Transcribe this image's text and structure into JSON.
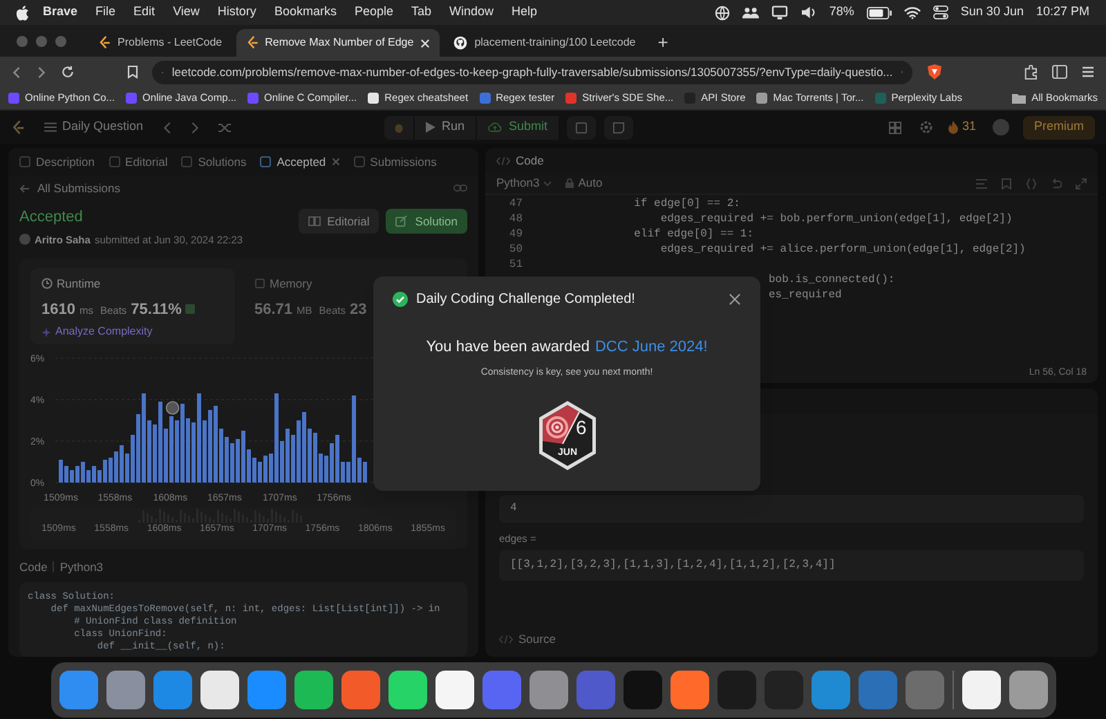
{
  "menu_bar": {
    "app": "Brave",
    "menus": [
      "File",
      "Edit",
      "View",
      "History",
      "Bookmarks",
      "People",
      "Tab",
      "Window",
      "Help"
    ],
    "battery": "78%",
    "date": "Sun 30 Jun",
    "time": "10:27 PM"
  },
  "browser": {
    "tabs": [
      {
        "title": "Problems - LeetCode",
        "selected": false
      },
      {
        "title": "Remove Max Number of Edge",
        "selected": true
      },
      {
        "title": "placement-training/100 Leetcode",
        "selected": false
      }
    ],
    "new_tab": "+",
    "url": "leetcode.com/problems/remove-max-number-of-edges-to-keep-graph-fully-traversable/submissions/1305007355/?envType=daily-questio...",
    "bookmarks": [
      {
        "label": "Online Python Co...",
        "color": "#6d4aff"
      },
      {
        "label": "Online Java Comp...",
        "color": "#6d4aff"
      },
      {
        "label": "Online C Compiler...",
        "color": "#6d4aff"
      },
      {
        "label": "Regex cheatsheet",
        "color": "#e5e5e5"
      },
      {
        "label": "Regex tester",
        "color": "#3b6fd9"
      },
      {
        "label": "Striver's SDE She...",
        "color": "#e0342b"
      },
      {
        "label": "API Store",
        "color": "#222222"
      },
      {
        "label": "Mac Torrents | Tor...",
        "color": "#9a9a9a"
      },
      {
        "label": "Perplexity Labs",
        "color": "#1f5f5a"
      }
    ],
    "all_bookmarks": "All Bookmarks"
  },
  "leetcode_nav": {
    "title": "Daily Question",
    "run": "Run",
    "submit": "Submit",
    "streak": "31",
    "premium": "Premium"
  },
  "left_panel": {
    "tabs": [
      {
        "label": "Description",
        "selected": false
      },
      {
        "label": "Editorial",
        "selected": false
      },
      {
        "label": "Solutions",
        "selected": false
      },
      {
        "label": "Accepted",
        "selected": true
      },
      {
        "label": "Submissions",
        "selected": false
      }
    ],
    "back_link": "All Submissions",
    "status": "Accepted",
    "author": "Aritro Saha",
    "submitted": "submitted at Jun 30, 2024 22:23",
    "buttons": [
      {
        "label": "Editorial",
        "kind": "secondary"
      },
      {
        "label": "Solution",
        "kind": "primary"
      }
    ],
    "runtime": {
      "label": "Runtime",
      "value": "1610",
      "unit": "ms",
      "beats_label": "Beats",
      "beats": "75.11%",
      "analyze": "Analyze Complexity"
    },
    "memory": {
      "label": "Memory",
      "value": "56.71",
      "unit": "MB",
      "beats_label": "Beats",
      "beats": "23"
    },
    "chart_data": {
      "type": "bar",
      "x": [
        1509,
        1514,
        1519,
        1524,
        1529,
        1534,
        1539,
        1544,
        1549,
        1554,
        1559,
        1564,
        1569,
        1574,
        1579,
        1584,
        1589,
        1594,
        1599,
        1604,
        1609,
        1614,
        1619,
        1624,
        1629,
        1634,
        1639,
        1644,
        1649,
        1654,
        1659,
        1664,
        1669,
        1674,
        1679,
        1684,
        1689,
        1694,
        1699,
        1704,
        1709,
        1714,
        1719,
        1724,
        1729,
        1734,
        1739,
        1744,
        1749,
        1754,
        1759,
        1764,
        1769,
        1774,
        1779,
        1784
      ],
      "values": [
        1.1,
        0.8,
        0.6,
        0.8,
        1.0,
        0.6,
        0.8,
        0.6,
        1.1,
        1.2,
        1.5,
        1.8,
        1.4,
        2.3,
        3.3,
        4.3,
        3.0,
        2.8,
        3.9,
        2.6,
        3.2,
        3.0,
        3.8,
        3.1,
        2.9,
        4.3,
        3.0,
        3.5,
        3.7,
        2.6,
        2.2,
        1.9,
        2.1,
        2.5,
        1.6,
        1.2,
        1.0,
        1.3,
        1.4,
        4.3,
        2.0,
        2.6,
        2.3,
        3.0,
        3.4,
        2.6,
        2.4,
        1.4,
        1.3,
        1.9,
        2.3,
        1.0,
        1.0,
        4.2,
        1.2,
        1.0
      ],
      "xlim": [
        1504,
        1794
      ],
      "ylim": [
        0,
        6
      ],
      "yticks": [
        {
          "value": 0,
          "label": "0%"
        },
        {
          "value": 2,
          "label": "2%"
        },
        {
          "value": 4,
          "label": "4%"
        },
        {
          "value": 6,
          "label": "6%"
        }
      ],
      "xticks": [
        {
          "value": 1509,
          "label": "1509ms"
        },
        {
          "value": 1558,
          "label": "1558ms"
        },
        {
          "value": 1608,
          "label": "1608ms"
        },
        {
          "value": 1657,
          "label": "1657ms"
        },
        {
          "value": 1707,
          "label": "1707ms"
        },
        {
          "value": 1756,
          "label": "1756ms"
        }
      ]
    },
    "range_labels": [
      "1509ms",
      "1558ms",
      "1608ms",
      "1657ms",
      "1707ms",
      "1756ms",
      "1806ms",
      "1855ms"
    ],
    "code_label": "Code",
    "code_language": "Python3",
    "code_lines": [
      "class Solution:",
      "    def maxNumEdgesToRemove(self, n: int, edges: List[List[int]]) -> in",
      "        # UnionFind class definition",
      "        class UnionFind:",
      "            def __init__(self, n):"
    ]
  },
  "editor": {
    "title": "Code",
    "language": "Python3",
    "mode": "Auto",
    "lines": [
      {
        "number": "47",
        "code": "            if edge[0] == 2:"
      },
      {
        "number": "48",
        "code": "                edges_required += bob.perform_union(edge[1], edge[2])"
      },
      {
        "number": "49",
        "code": "            elif edge[0] == 1:"
      },
      {
        "number": "50",
        "code": "                edges_required += alice.perform_union(edge[1], edge[2])"
      },
      {
        "number": "51"
      }
    ],
    "hidden_fragments": [
      "bob.is_connected():",
      "es_required"
    ],
    "cursor": "Ln 56, Col 18"
  },
  "testcase": {
    "n_value": "4",
    "edges_label": "edges =",
    "edges_value": "[[3,1,2],[3,2,3],[1,1,3],[1,2,4],[1,1,2],[2,3,4]]",
    "source": "Source"
  },
  "modal": {
    "title": "Daily Coding Challenge Completed!",
    "message": "You have been awarded",
    "award": "DCC June 2024!",
    "subtitle": "Consistency is key, see you next month!",
    "badge_day": "6",
    "badge_month": "JUN"
  },
  "dock": {
    "apps": [
      {
        "color": "#2f8cf0"
      },
      {
        "color": "#8a8fa0"
      },
      {
        "color": "#1e88e5"
      },
      {
        "color": "#e8e8e8"
      },
      {
        "color": "#1a8cff"
      },
      {
        "color": "#1db954"
      },
      {
        "color": "#f25a29"
      },
      {
        "color": "#25d366"
      },
      {
        "color": "#f5f5f5"
      },
      {
        "color": "#5865f2"
      },
      {
        "color": "#8e8e93"
      },
      {
        "color": "#5059c9"
      },
      {
        "color": "#111111"
      },
      {
        "color": "#ff6a2a"
      },
      {
        "color": "#1b1b1b"
      },
      {
        "color": "#222222"
      },
      {
        "color": "#1f8ad2"
      },
      {
        "color": "#2b6fb6"
      },
      {
        "color": "#6c6c6c"
      },
      {
        "color": "#f2f2f2"
      },
      {
        "color": "#9a9a9a"
      }
    ]
  }
}
